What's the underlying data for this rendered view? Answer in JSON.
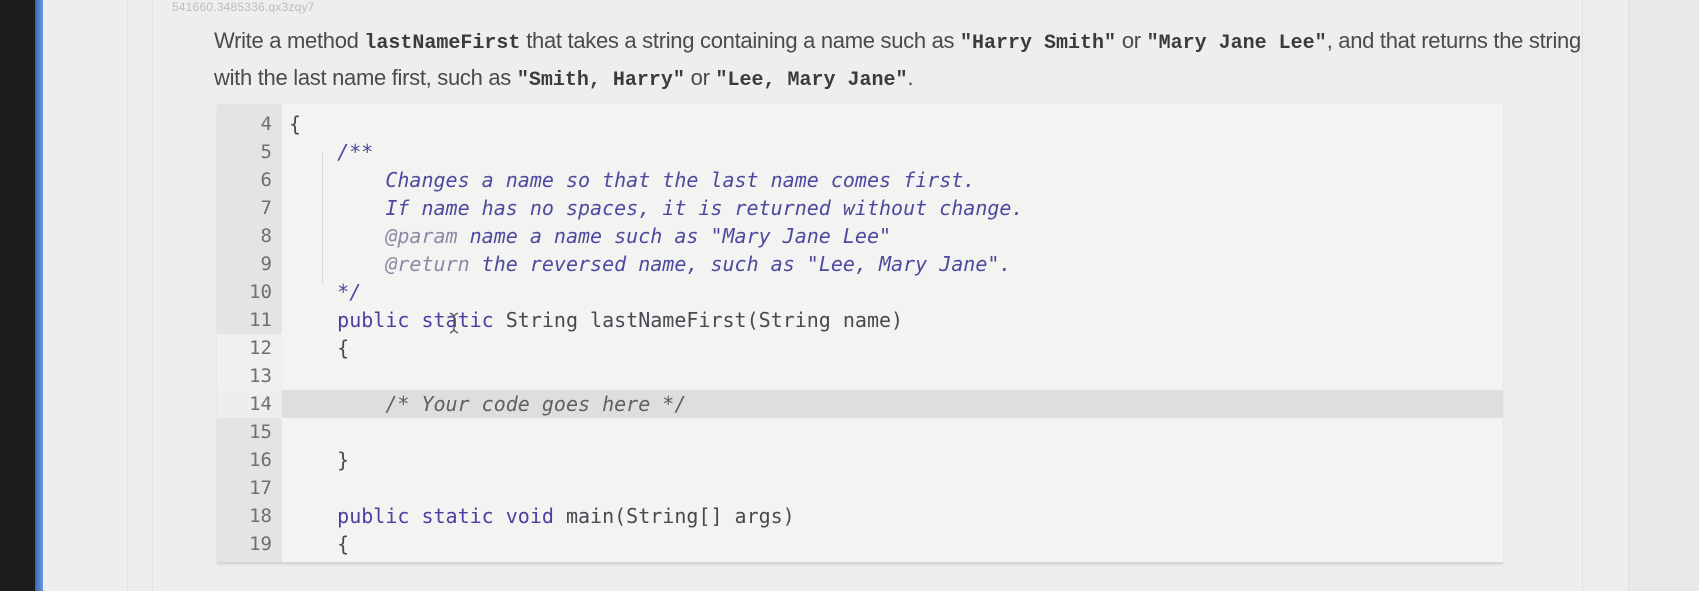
{
  "question_id": "541660.3485336.qx3zqy7",
  "prompt": {
    "part1": "Write a method ",
    "method_name": "lastNameFirst",
    "part2": " that takes a string containing a name such as ",
    "example_in_1": "\"Harry Smith\"",
    "or_1": " or ",
    "example_in_2": "\"Mary Jane Lee\"",
    "part3": ", and that returns the string with the last name first, such as ",
    "example_out_1": "\"Smith, Harry\"",
    "or_2": " or ",
    "example_out_2": "\"Lee, Mary Jane\"",
    "part4": "."
  },
  "editor": {
    "lines": [
      {
        "num": "4",
        "tokens": [
          {
            "t": "{",
            "c": "plain"
          }
        ]
      },
      {
        "num": "5",
        "tokens": [
          {
            "t": "    /**",
            "c": "doc"
          }
        ]
      },
      {
        "num": "6",
        "tokens": [
          {
            "t": "        Changes a name so that the last name comes first.",
            "c": "doc"
          }
        ]
      },
      {
        "num": "7",
        "tokens": [
          {
            "t": "        If name has no spaces, it is returned without change.",
            "c": "doc"
          }
        ]
      },
      {
        "num": "8",
        "tokens": [
          {
            "t": "        @param",
            "c": "tag"
          },
          {
            "t": " name a name such as \"Mary Jane Lee\"",
            "c": "doc"
          }
        ]
      },
      {
        "num": "9",
        "tokens": [
          {
            "t": "        @return",
            "c": "tag"
          },
          {
            "t": " the reversed name, such as \"Lee, Mary Jane\".",
            "c": "doc"
          }
        ]
      },
      {
        "num": "10",
        "tokens": [
          {
            "t": "    */",
            "c": "doc"
          }
        ]
      },
      {
        "num": "11",
        "tokens": [
          {
            "t": "    public static",
            "c": "kw"
          },
          {
            "t": " String lastNameFirst(String name)",
            "c": "plain"
          }
        ]
      },
      {
        "num": "12",
        "tokens": [
          {
            "t": "    {",
            "c": "plain"
          }
        ]
      },
      {
        "num": "13",
        "tokens": []
      },
      {
        "num": "14",
        "tokens": [
          {
            "t": "        /* Your code goes here */",
            "c": "cm"
          }
        ],
        "highlighted": true
      },
      {
        "num": "15",
        "tokens": []
      },
      {
        "num": "16",
        "tokens": [
          {
            "t": "    }",
            "c": "plain"
          }
        ]
      },
      {
        "num": "17",
        "tokens": []
      },
      {
        "num": "18",
        "tokens": [
          {
            "t": "    public static void",
            "c": "kw"
          },
          {
            "t": " main(String[] args)",
            "c": "plain"
          }
        ]
      },
      {
        "num": "19",
        "tokens": [
          {
            "t": "    {",
            "c": "plain"
          }
        ]
      }
    ]
  }
}
